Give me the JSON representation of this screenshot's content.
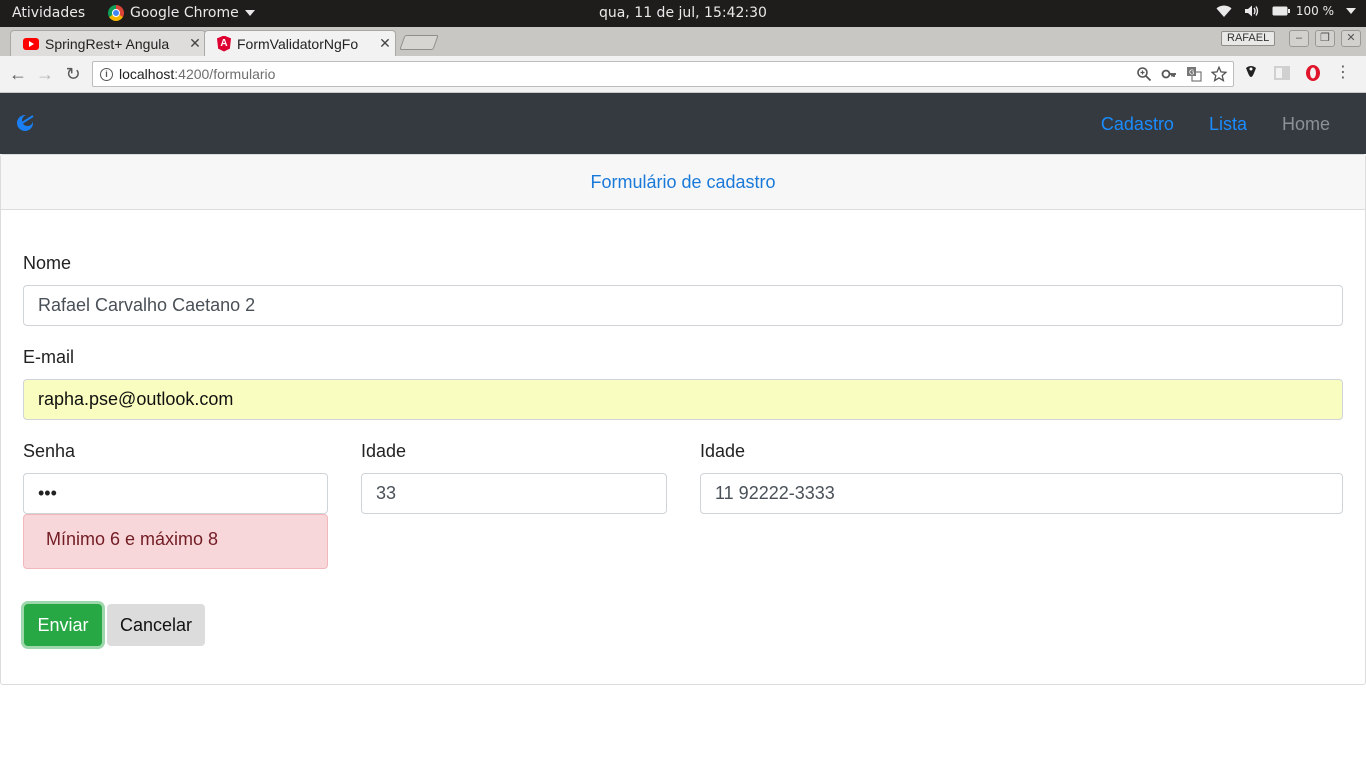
{
  "os": {
    "activities": "Atividades",
    "app_name": "Google Chrome",
    "clock": "qua, 11 de jul, 15:42:30",
    "battery": "100 %"
  },
  "browser": {
    "tabs": [
      {
        "title": "SpringRest+ Angula",
        "icon": "youtube-icon",
        "active": false
      },
      {
        "title": "FormValidatorNgFo",
        "icon": "angular-icon",
        "active": true
      }
    ],
    "profile": "RAFAEL",
    "url_host": "localhost",
    "url_rest": ":4200/formulario"
  },
  "navbar": {
    "links": [
      "Cadastro",
      "Lista",
      "Home"
    ],
    "link_color": "#1a8cff",
    "bg_color": "#343a40"
  },
  "form": {
    "title": "Formulário de cadastro",
    "nome_label": "Nome",
    "nome_value": "Rafael Carvalho Caetano 2",
    "email_label": "E-mail",
    "email_value": "rapha.pse@outlook.com",
    "senha_label": "Senha",
    "senha_value": "•••",
    "senha_error": "Mínimo 6 e máximo 8",
    "idade_label": "Idade",
    "idade_value": "33",
    "telefone_label": "Idade",
    "telefone_value": "11 92222-3333",
    "submit_label": "Enviar",
    "cancel_label": "Cancelar"
  }
}
